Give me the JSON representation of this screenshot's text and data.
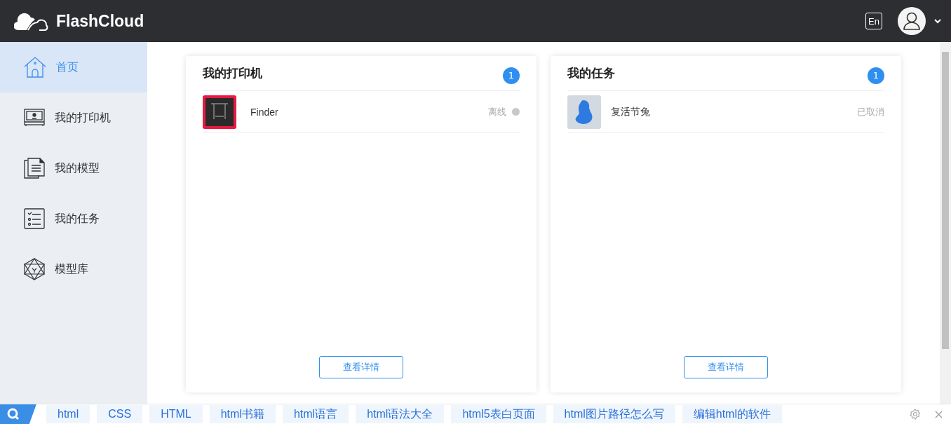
{
  "header": {
    "brand": "FlashCloud",
    "language_button": "En"
  },
  "sidebar": {
    "items": [
      {
        "label": "首页",
        "kind": "home",
        "selected": true
      },
      {
        "label": "我的打印机",
        "kind": "printer",
        "selected": false
      },
      {
        "label": "我的模型",
        "kind": "model",
        "selected": false
      },
      {
        "label": "我的任务",
        "kind": "task",
        "selected": false
      },
      {
        "label": "模型库",
        "kind": "library",
        "selected": false
      }
    ]
  },
  "cards": [
    {
      "title": "我的打印机",
      "count": "1",
      "kind": "printer",
      "items": [
        {
          "name": "Finder",
          "status": "离线",
          "online": false
        }
      ],
      "button": "查看详情"
    },
    {
      "title": "我的任务",
      "count": "1",
      "kind": "task",
      "items": [
        {
          "name": "复活节兔",
          "status": "已取消"
        }
      ],
      "button": "查看详情"
    }
  ],
  "search_bar": {
    "tags": [
      "html",
      "CSS",
      "HTML",
      "html书籍",
      "html语言",
      "html语法大全",
      "html5表白页面",
      "html图片路径怎么写",
      "编辑html的软件"
    ]
  }
}
